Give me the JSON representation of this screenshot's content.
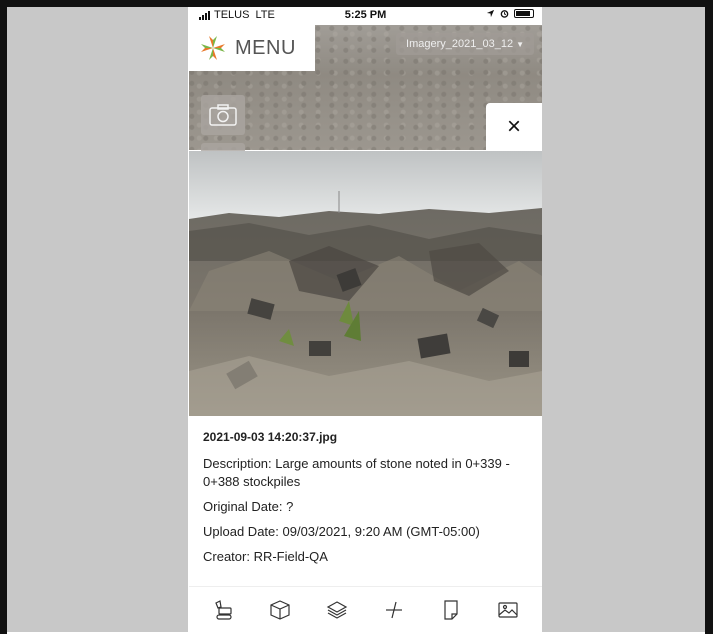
{
  "status_bar": {
    "carrier": "TELUS",
    "network": "LTE",
    "time": "5:25 PM"
  },
  "header": {
    "menu_label": "MENU",
    "imagery_select": "Imagery_2021_03_12"
  },
  "close_label": "×",
  "photo_details": {
    "filename": "2021-09-03 14:20:37.jpg",
    "description": "Description: Large amounts of stone noted in 0+339 - 0+388 stockpiles",
    "original_date": "Original Date: ?",
    "upload_date": "Upload Date: 09/03/2021, 9:20 AM (GMT-05:00)",
    "creator": "Creator: RR-Field-QA"
  },
  "toolbar": {
    "icons": [
      "excavator-icon",
      "cube-icon",
      "layers-icon",
      "measure-icon",
      "note-icon",
      "image-icon"
    ]
  },
  "colors": {
    "side_background": "#c8c8c8",
    "logo_orange": "#e8782a",
    "logo_green": "#7ab648"
  }
}
